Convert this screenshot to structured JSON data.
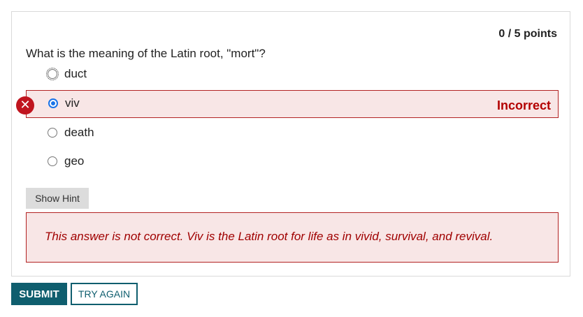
{
  "question": {
    "points": "0 / 5 points",
    "prompt": "What is the meaning of the Latin root, \"mort\"?",
    "options": [
      {
        "label": "duct",
        "selected": false
      },
      {
        "label": "viv",
        "selected": true,
        "status": "Incorrect"
      },
      {
        "label": "death",
        "selected": false
      },
      {
        "label": "geo",
        "selected": false
      }
    ],
    "hint_label": "Show Hint",
    "feedback": "This answer is not correct. Viv is the Latin root for life as in vivid, survival, and revival."
  },
  "actions": {
    "submit_label": "SUBMIT",
    "try_again_label": "TRY AGAIN"
  },
  "colors": {
    "accent": "#0f5e6e",
    "error": "#b30000",
    "error_bg": "#f8e6e6"
  }
}
